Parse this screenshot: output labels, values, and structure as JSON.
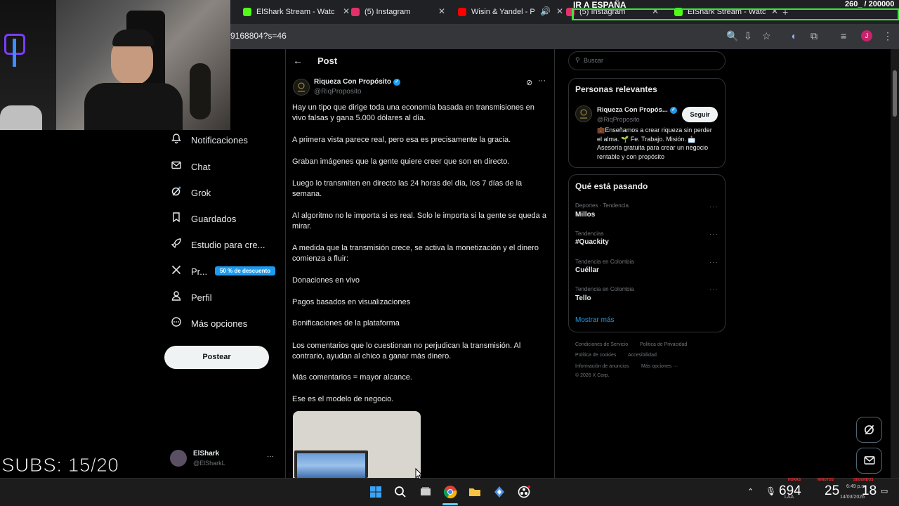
{
  "browser": {
    "tabs": [
      {
        "title": "ElShark Stream - Watc",
        "icon": "kick-icon",
        "color": "#53fc18"
      },
      {
        "title": "(5) Instagram",
        "icon": "instagram-icon",
        "color": "#e1306c"
      },
      {
        "title": "Wisin & Yandel - P",
        "icon": "youtube-icon",
        "color": "#ff0000"
      },
      {
        "title": "(5) Instagram",
        "icon": "instagram-icon",
        "color": "#e1306c"
      },
      {
        "title": "ElShark Stream - Watc",
        "icon": "kick-icon",
        "color": "#53fc18"
      }
    ],
    "url": "9168804?s=46"
  },
  "overlay": {
    "banner": "IR A ESPAÑA",
    "goal": "260_ / 200000",
    "subs": "SUBS: 15/20",
    "progress_fraction": 0.0013
  },
  "nav": {
    "items": [
      {
        "label": "Notificaciones",
        "icon": "bell-icon"
      },
      {
        "label": "Chat",
        "icon": "envelope-icon"
      },
      {
        "label": "Grok",
        "icon": "grok-icon"
      },
      {
        "label": "Guardados",
        "icon": "bookmark-icon"
      },
      {
        "label": "Estudio para cre...",
        "icon": "rocket-icon"
      },
      {
        "label": "Pr...",
        "icon": "x-logo-icon"
      },
      {
        "label": "Perfil",
        "icon": "person-icon"
      },
      {
        "label": "Más opciones",
        "icon": "more-circle-icon"
      }
    ],
    "promo_badge": "50 % de descuento",
    "post_button": "Postear"
  },
  "account": {
    "name": "ElShark",
    "handle": "@ElSharkL",
    "more": "···"
  },
  "post": {
    "header_title": "Post",
    "author_name": "Riqueza Con Propósito",
    "author_handle": "@RiqProposito",
    "paragraphs": [
      "Hay un tipo que dirige toda una economía basada en transmisiones en vivo falsas y gana 5.000 dólares al día.",
      "A primera vista parece real, pero esa es precisamente la gracia.",
      "Graban imágenes que la gente quiere creer que son en directo.",
      "Luego lo transmiten en directo las 24 horas del día, los 7 días de la semana.",
      "Al algoritmo no le importa si es real. Solo le importa si la gente se queda a mirar.",
      "A medida que la transmisión crece, se activa la monetización y el dinero comienza a fluir:",
      "Donaciones en vivo",
      "Pagos basados en visualizaciones",
      "Bonificaciones de la plataforma",
      "Los comentarios que lo cuestionan no perjudican la transmisión. Al contrario, ayudan al chico a ganar más dinero.",
      "Más comentarios = mayor alcance.",
      "Ese es el modelo de negocio."
    ]
  },
  "sidebar": {
    "search_placeholder": "Buscar",
    "relevant_title": "Personas relevantes",
    "relevant": {
      "name": "Riqueza Con Propós...",
      "handle": "@RiqProposito",
      "follow": "Seguir",
      "bio": "💼Enseñamos a crear riqueza sin perder el alma. 🌱 Fe. Trabajo. Misión. 📩 Asesoría gratuita para crear un negocio rentable y con propósito"
    },
    "trends_title": "Qué está pasando",
    "trends": [
      {
        "meta": "Deportes · Tendencia",
        "name": "Millos"
      },
      {
        "meta": "Tendencias",
        "name": "#Quackity"
      },
      {
        "meta": "Tendencia en Colombia",
        "name": "Cuéllar"
      },
      {
        "meta": "Tendencia en Colombia",
        "name": "Tello"
      }
    ],
    "show_more": "Mostrar más",
    "footer": {
      "terms": "Condiciones de Servicio",
      "privacy": "Política de Privacidad",
      "cookies": "Política de cookies",
      "accessibility": "Accesibilidad",
      "ads": "Información de anuncios",
      "more": "Más opciones ···",
      "copyright": "© 2026 X Corp."
    }
  },
  "taskbar": {
    "counter1": "694",
    "counter2": "25",
    "counter3": "18",
    "label_hours": "HORAS",
    "label_minutes": "MINUTOS",
    "label_seconds": "SEGUNDOS",
    "time": "6:49 p.m.",
    "date": "14/03/2026",
    "lang": "LAA"
  }
}
